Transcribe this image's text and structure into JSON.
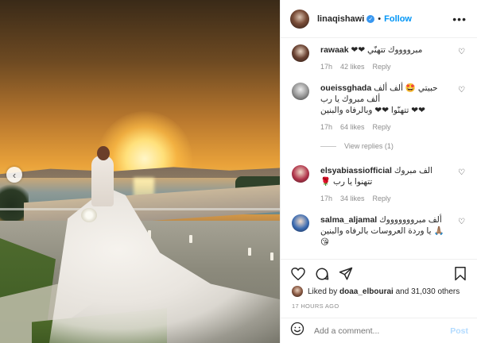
{
  "post_header": {
    "username": "linaqishawi",
    "follow_label": "Follow",
    "dot": "•"
  },
  "comments": [
    {
      "username": "rawaak",
      "text": "مبرووووك تتهنّي ❤❤",
      "time": "17h",
      "likes": "42 likes",
      "reply": "Reply"
    },
    {
      "username": "oueissghada",
      "text_line1": "حبيتي 🤩 ألف ألف",
      "text_line2": "ألف مبروك يا رب",
      "text_line3": "❤❤ تتهنّوا ❤❤ وبالرفاه والبنين",
      "time": "17h",
      "likes": "64 likes",
      "reply": "Reply",
      "view_replies": "View replies (1)"
    },
    {
      "username": "elsyabiassiofficial",
      "text_line1": "الف مبروك",
      "text_line2": "تتهنوا يا رب 🌹",
      "time": "17h",
      "likes": "34 likes",
      "reply": "Reply"
    },
    {
      "username": "salma_aljamal",
      "text_line1": "ألف مبروووووووك",
      "text_line2": "🙏🏽 يا وردة العروسات بالرفاه والبنين",
      "text_line3": "😘",
      "time": "",
      "likes": "",
      "reply": ""
    }
  ],
  "likes": {
    "prefix": "Liked by",
    "user": "doaa_elbourai",
    "suffix": "and 31,030 others"
  },
  "time_ago": "17 HOURS AGO",
  "add_comment": {
    "placeholder": "Add a comment...",
    "post_label": "Post"
  },
  "icons": {
    "more": "more-icon",
    "heart": "heart-icon",
    "comment": "comment-icon",
    "share": "share-icon",
    "save": "bookmark-icon",
    "emoji": "emoji-icon",
    "prev": "chevron-left-icon"
  },
  "colors": {
    "link_blue": "#0095f6",
    "verified_blue": "#3897f0",
    "heart_red": "#ed4956",
    "muted": "#8e8e8e"
  }
}
